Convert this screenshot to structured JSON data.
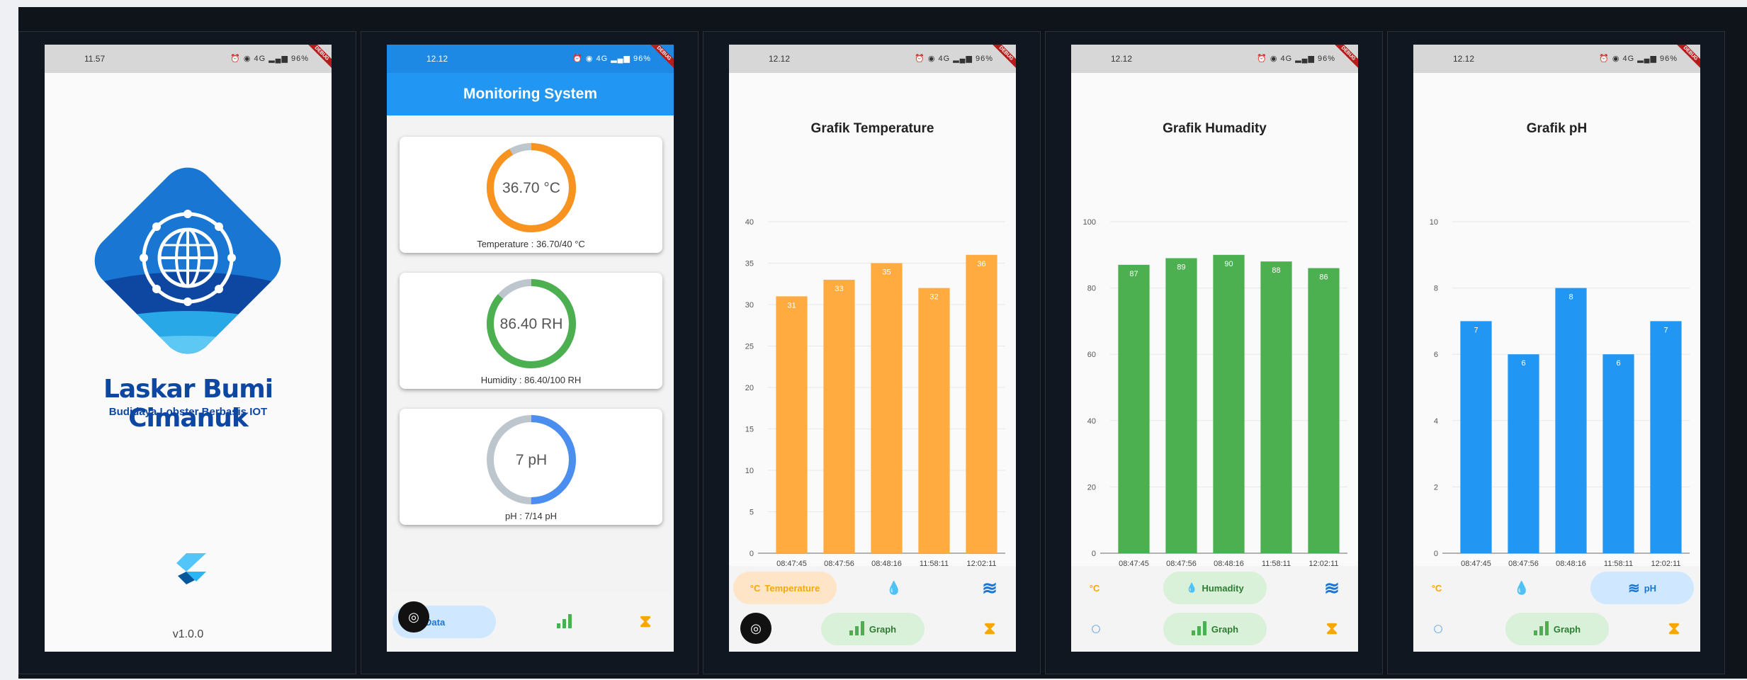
{
  "status_bar": {
    "splash_time": "11.57",
    "time": "12.12",
    "icons": "⏰ ◉ 4G ▂▄▆ 96%",
    "debug_label": "DEBUG"
  },
  "splash": {
    "brand": "Laskar Bumi Cimanuk",
    "tagline": "Budidaya Lobster Berbasis IOT",
    "version": "v1.0.0"
  },
  "monitoring": {
    "appbar_title": "Monitoring System",
    "gauges": [
      {
        "value_text": "36.70 °C",
        "label": "Temperature : 36.70/40 °C",
        "fraction": 0.9175,
        "color": "#f7931e"
      },
      {
        "value_text": "86.40 RH",
        "label": "Humidity : 86.40/100 RH",
        "fraction": 0.864,
        "color": "#4caf50"
      },
      {
        "value_text": "7 pH",
        "label": "pH : 7/14 pH",
        "fraction": 0.5,
        "color": "#4a8ef0"
      }
    ],
    "nav": {
      "data_label": "Data"
    }
  },
  "graph_nav": {
    "temperature_label": "Temperature",
    "humidity_label": "Humadity",
    "ph_label": "pH",
    "graph_label": "Graph",
    "celsius_icon": "°C"
  },
  "chart_data": [
    {
      "type": "bar",
      "title": "Grafik Temperature",
      "categories": [
        "08:47:45",
        "08:47:56",
        "08:48:16",
        "11:58:11",
        "12:02:11"
      ],
      "values": [
        31,
        33,
        35,
        32,
        36
      ],
      "ylim": [
        0,
        40
      ],
      "yticks": [
        0,
        5,
        10,
        15,
        20,
        25,
        30,
        35,
        40
      ],
      "color": "#ffab40",
      "grid": true
    },
    {
      "type": "bar",
      "title": "Grafik Humadity",
      "categories": [
        "08:47:45",
        "08:47:56",
        "08:48:16",
        "11:58:11",
        "12:02:11"
      ],
      "values": [
        87,
        89,
        90,
        88,
        86
      ],
      "ylim": [
        0,
        100
      ],
      "yticks": [
        0,
        20,
        40,
        60,
        80,
        100
      ],
      "color": "#4caf50",
      "grid": true
    },
    {
      "type": "bar",
      "title": "Grafik pH",
      "categories": [
        "08:47:45",
        "08:47:56",
        "08:48:16",
        "11:58:11",
        "12:02:11"
      ],
      "values": [
        7,
        6,
        8,
        6,
        7
      ],
      "ylim": [
        0,
        10
      ],
      "yticks": [
        0,
        2,
        4,
        6,
        8,
        10
      ],
      "color": "#2196f3",
      "grid": true
    }
  ]
}
